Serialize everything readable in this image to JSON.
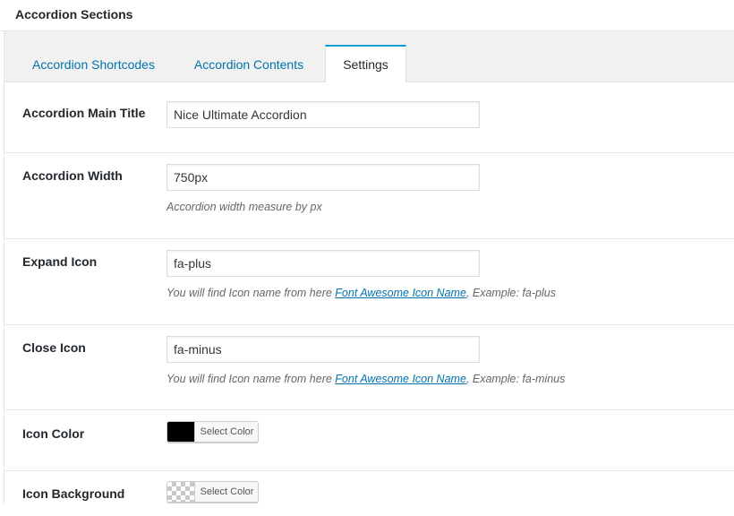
{
  "panel": {
    "title": "Accordion Sections"
  },
  "tabs": [
    {
      "label": "Accordion Shortcodes"
    },
    {
      "label": "Accordion Contents"
    },
    {
      "label": "Settings"
    }
  ],
  "fields": {
    "main_title": {
      "label": "Accordion Main Title",
      "value": "Nice Ultimate Accordion"
    },
    "width": {
      "label": "Accordion Width",
      "value": "750px",
      "description": "Accordion width measure by px"
    },
    "expand_icon": {
      "label": "Expand Icon",
      "value": "fa-plus",
      "desc_prefix": "You will find Icon name from here ",
      "desc_link": "Font Awesome Icon Name",
      "desc_suffix": ", Example: fa-plus"
    },
    "close_icon": {
      "label": "Close Icon",
      "value": "fa-minus",
      "desc_prefix": "You will find Icon name from here ",
      "desc_link": "Font Awesome Icon Name",
      "desc_suffix": ", Example: fa-minus"
    },
    "icon_color": {
      "label": "Icon Color",
      "button": "Select Color",
      "color": "#000000"
    },
    "icon_background": {
      "label": "Icon Background",
      "button": "Select Color",
      "color": "transparent"
    }
  },
  "colors": {
    "accent": "#00a0d2",
    "link": "#0073aa"
  }
}
